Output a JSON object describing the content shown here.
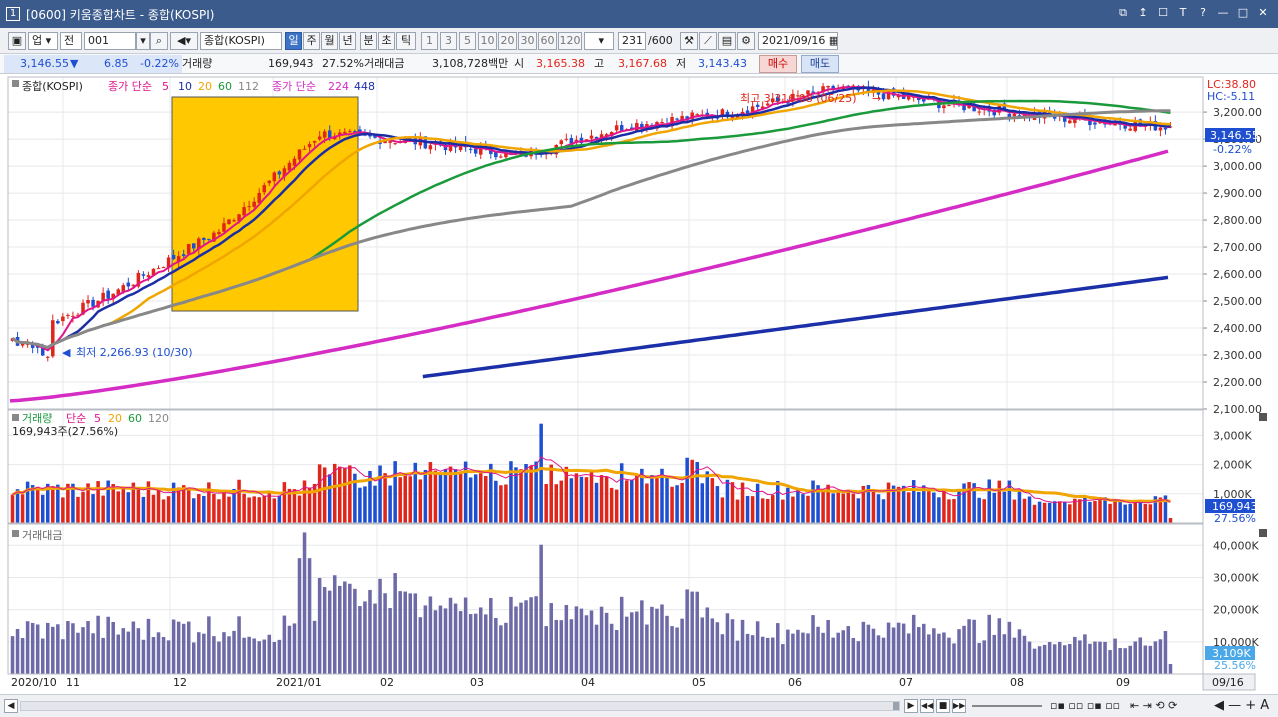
{
  "window": {
    "icon_label": "1",
    "title": "[0600] 키움종합차트 - 종합(KOSPI)",
    "buttons": [
      "⧉",
      "↥",
      "☐",
      "T",
      "?",
      "—",
      "□",
      "✕"
    ]
  },
  "toolbar": {
    "market": "업",
    "scope": "전",
    "code": "001",
    "name": "종합(KOSPI)",
    "periods": [
      "일",
      "주",
      "월",
      "년",
      "분",
      "초",
      "틱"
    ],
    "active_period": "일",
    "intervals": [
      "1",
      "3",
      "5",
      "10",
      "20",
      "30",
      "60",
      "120"
    ],
    "count": "231",
    "count_total": "/600",
    "date": "2021/09/16"
  },
  "quote": {
    "price": "3,146.55",
    "change_arrow": "▼",
    "change": "6.85",
    "change_pct": "-0.22%",
    "volume_label": "거래량",
    "volume": "169,943",
    "volume_pct": "27.52%",
    "amount_label": "거래대금",
    "amount": "3,108,728백만",
    "open_label": "시",
    "open": "3,165.38",
    "high_label": "고",
    "high": "3,167.68",
    "low_label": "저",
    "low": "3,143.43",
    "buy_label": "매수",
    "sell_label": "매도"
  },
  "price_panel": {
    "legend_name": "종합(KOSPI)",
    "legend_ma1_label": "종가 단순",
    "legend_ma1_periods": [
      "5",
      "10",
      "20",
      "60",
      "112"
    ],
    "legend_ma2_label": "종가 단순",
    "legend_ma2_periods": [
      "224",
      "448"
    ],
    "lc": "LC:38.80",
    "hc": "HC:-5.11",
    "y_ticks": [
      "3,200.00",
      "3,100.00",
      "3,000.00",
      "2,900.00",
      "2,800.00",
      "2,700.00",
      "2,600.00",
      "2,500.00",
      "2,400.00",
      "2,300.00",
      "2,200.00",
      "2,100.00"
    ],
    "last_value": "3,146.55",
    "last_pct": "-0.22%",
    "high_note": "최고 3,316.08 (06/25)",
    "low_note": "최저 2,266.93 (10/30)"
  },
  "volume_panel": {
    "legend_title": "거래량",
    "legend_ma_label": "단순",
    "legend_ma_periods": [
      "5",
      "20",
      "60",
      "120"
    ],
    "current": "169,943주(27.56%)",
    "y_ticks": [
      "3,000K",
      "2,000K",
      "1,000K"
    ],
    "last_value": "169,943",
    "last_pct": "27.56%"
  },
  "amount_panel": {
    "legend_title": "거래대금",
    "y_ticks": [
      "40,000K",
      "30,000K",
      "20,000K",
      "10,000K"
    ],
    "last_value": "3,109K",
    "last_pct": "25.56%"
  },
  "x_axis": {
    "labels": [
      "2020/10",
      "11",
      "12",
      "2021/01",
      "02",
      "03",
      "04",
      "05",
      "06",
      "07",
      "08",
      "09"
    ],
    "right_label": "09/16"
  },
  "colors": {
    "up": "#e0251b",
    "down": "#1f4fd1",
    "ma5": "#e0158c",
    "ma10": "#1c2ea6",
    "ma20": "#f0a500",
    "ma60": "#1a9a3a",
    "ma112": "#888888",
    "ma224": "#d42cc4",
    "ma448": "#1a2fa8",
    "highlight": "#ffc800"
  },
  "chart_data": {
    "type": "candlestick",
    "title": "종합(KOSPI)",
    "period": "daily",
    "x_range": [
      "2020/10",
      "2021/09/16"
    ],
    "ylim": [
      2100,
      3330
    ],
    "last": {
      "open": 3165.38,
      "high": 3167.68,
      "low": 3143.43,
      "close": 3146.55,
      "change": -6.85,
      "change_pct": -0.22
    },
    "extremes": {
      "high": {
        "value": 3316.08,
        "date": "06/25"
      },
      "low": {
        "value": 2266.93,
        "date": "10/30"
      }
    },
    "close_monthly": {
      "months": [
        "2020/10",
        "11",
        "12",
        "2021/01",
        "02",
        "03",
        "04",
        "05",
        "06",
        "07",
        "08",
        "09"
      ],
      "values": [
        2350,
        2530,
        2760,
        3120,
        3090,
        3040,
        3150,
        3200,
        3290,
        3230,
        3180,
        3146.55
      ]
    },
    "volume": {
      "last": 169943,
      "last_pct": 27.56,
      "ylim": [
        0,
        3800
      ]
    },
    "amount": {
      "last_k": 3109,
      "last_pct": 25.56,
      "ylim": [
        0,
        46000
      ]
    }
  }
}
